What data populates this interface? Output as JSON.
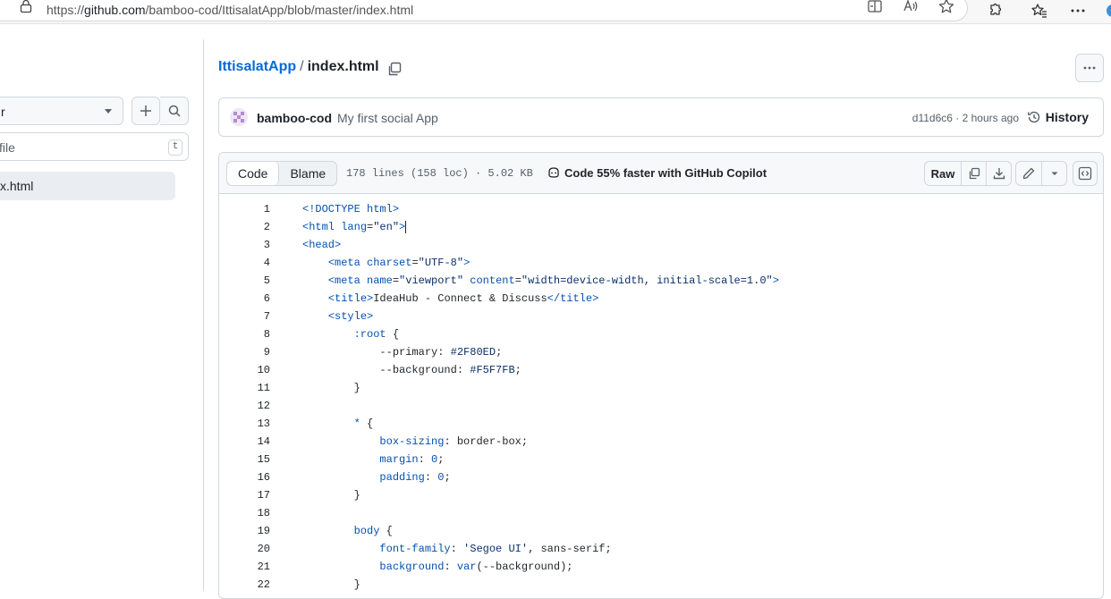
{
  "browser": {
    "url_prefix": "https://",
    "url_host": "github.com",
    "url_path": "/bamboo-cod/IttisalatApp/blob/master/index.html"
  },
  "sidebar": {
    "branch_label": "r",
    "filter_placeholder": "file",
    "filter_shortcut": "t",
    "active_file": "x.html"
  },
  "breadcrumb": {
    "repo": "IttisalatApp",
    "separator": "/",
    "file": "index.html"
  },
  "commit": {
    "author": "bamboo-cod",
    "message": "My first social App",
    "meta": "d11d6c6 · 2 hours ago",
    "history_label": "History"
  },
  "file_header": {
    "tab_code": "Code",
    "tab_blame": "Blame",
    "stats": "178 lines (158 loc) · 5.02 KB",
    "copilot_text": "Code 55% faster with GitHub Copilot",
    "raw_label": "Raw"
  },
  "code_lines": [
    {
      "n": "1"
    },
    {
      "n": "2"
    },
    {
      "n": "3"
    },
    {
      "n": "4"
    },
    {
      "n": "5"
    },
    {
      "n": "6"
    },
    {
      "n": "7"
    },
    {
      "n": "8"
    },
    {
      "n": "9"
    },
    {
      "n": "10"
    },
    {
      "n": "11"
    },
    {
      "n": "12"
    },
    {
      "n": "13"
    },
    {
      "n": "14"
    },
    {
      "n": "15"
    },
    {
      "n": "16"
    },
    {
      "n": "17"
    },
    {
      "n": "18"
    },
    {
      "n": "19"
    },
    {
      "n": "20"
    },
    {
      "n": "21"
    },
    {
      "n": "22"
    }
  ],
  "code": {
    "l1": "<!DOCTYPE html>",
    "l2a": "<html ",
    "l2b": "lang",
    "l2c": "=",
    "l2d": "\"en\"",
    "l2e": ">",
    "l3": "<head>",
    "l4a": "<meta ",
    "l4b": "charset",
    "l4c": "=",
    "l4d": "\"UTF-8\"",
    "l4e": ">",
    "l5a": "<meta ",
    "l5b": "name",
    "l5c": "=",
    "l5d": "\"viewport\"",
    "l5e": " ",
    "l5f": "content",
    "l5g": "=",
    "l5h": "\"width=device-width, initial-scale=1.0\"",
    "l5i": ">",
    "l6a": "<title>",
    "l6b": "IdeaHub - Connect & Discuss",
    "l6c": "</title>",
    "l7": "<style>",
    "l8a": ":root",
    "l8b": " {",
    "l9a": "--primary",
    "l9b": ": ",
    "l9c": "#2F80ED",
    "l9d": ";",
    "l10a": "--background",
    "l10b": ": ",
    "l10c": "#F5F7FB",
    "l10d": ";",
    "l11": "}",
    "l13a": "*",
    "l13b": " {",
    "l14a": "box-sizing",
    "l14b": ": border-box;",
    "l15a": "margin",
    "l15b": ": ",
    "l15c": "0",
    "l15d": ";",
    "l16a": "padding",
    "l16b": ": ",
    "l16c": "0",
    "l16d": ";",
    "l17": "}",
    "l19a": "body",
    "l19b": " {",
    "l20a": "font-family",
    "l20b": ": ",
    "l20c": "'Segoe UI'",
    "l20d": ", sans-serif;",
    "l21a": "background",
    "l21b": ": ",
    "l21c": "var",
    "l21d": "(--background);",
    "l22": "}"
  },
  "colors": {
    "link": "#0969da",
    "border": "#d0d7de",
    "header_bg": "#f6f8fa"
  }
}
